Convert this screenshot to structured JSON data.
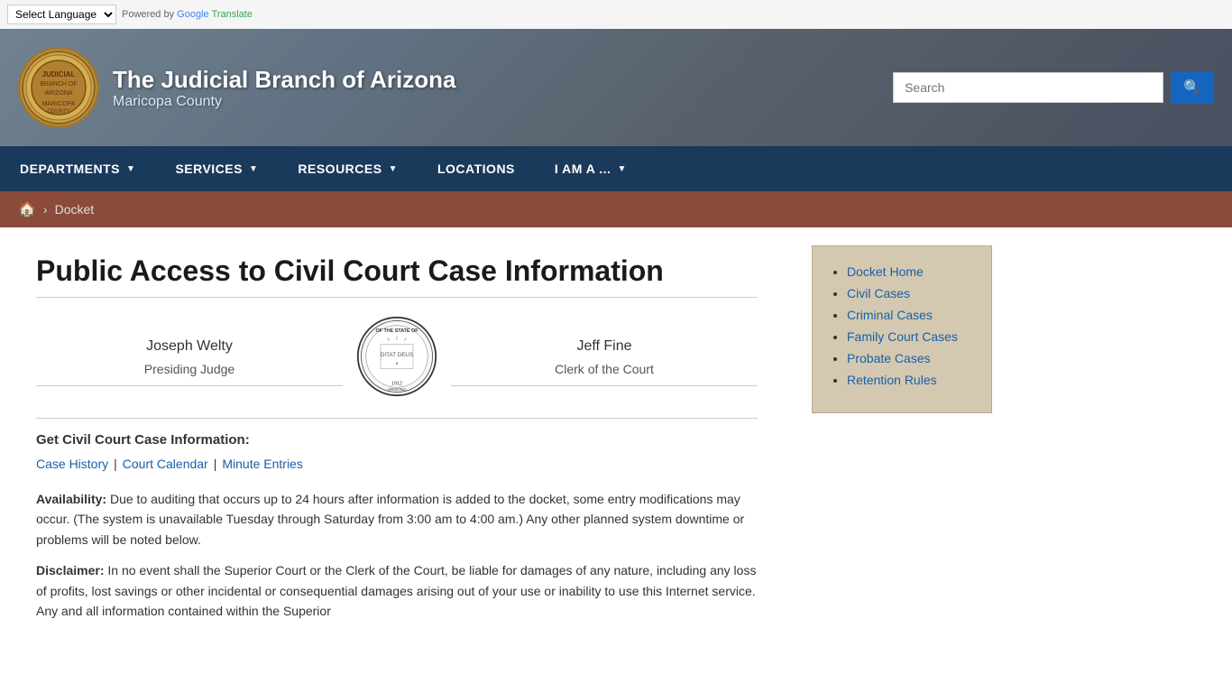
{
  "topbar": {
    "select_label": "Select Language",
    "powered_by": "Powered by",
    "google_label": "Google",
    "translate_label": "Translate"
  },
  "header": {
    "title": "The Judicial Branch of Arizona",
    "subtitle": "Maricopa County",
    "search_placeholder": "Search"
  },
  "nav": {
    "items": [
      {
        "label": "DEPARTMENTS",
        "has_arrow": true
      },
      {
        "label": "SERVICES",
        "has_arrow": true
      },
      {
        "label": "RESOURCES",
        "has_arrow": true
      },
      {
        "label": "LOCATIONS",
        "has_arrow": false
      },
      {
        "label": "I AM A ...",
        "has_arrow": true
      }
    ]
  },
  "breadcrumb": {
    "home_icon": "🏠",
    "separator": "›",
    "current": "Docket"
  },
  "page": {
    "title": "Public Access to Civil Court Case Information",
    "judge_left_name": "Joseph Welty",
    "judge_left_title": "Presiding Judge",
    "judge_right_name": "Jeff Fine",
    "judge_right_title": "Clerk of the Court",
    "get_info_label": "Get Civil Court Case Information:",
    "links": [
      {
        "label": "Case History"
      },
      {
        "label": "Court Calendar"
      },
      {
        "label": "Minute Entries"
      }
    ],
    "availability_heading": "Availability:",
    "availability_text": "Due to auditing that occurs up to 24 hours after information is added to the docket, some entry modifications may occur. (The system is unavailable Tuesday through Saturday from 3:00 am to 4:00 am.) Any other planned system downtime or problems will be noted below.",
    "disclaimer_heading": "Disclaimer:",
    "disclaimer_text": "In no event shall the Superior Court or the Clerk of the Court, be liable for damages of any nature, including any loss of profits, lost savings or other incidental or consequential damages arising out of your use or inability to use this Internet service. Any and all information contained within the Superior"
  },
  "sidebar": {
    "links": [
      {
        "label": "Docket Home"
      },
      {
        "label": "Civil Cases"
      },
      {
        "label": "Criminal Cases"
      },
      {
        "label": "Family Court Cases"
      },
      {
        "label": "Probate Cases"
      },
      {
        "label": "Retention Rules"
      }
    ]
  }
}
